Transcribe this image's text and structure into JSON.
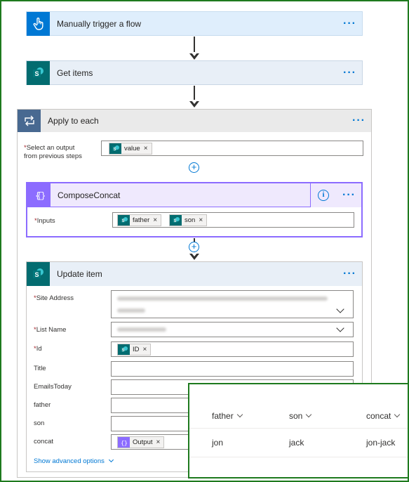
{
  "trigger": {
    "title": "Manually trigger a flow",
    "more": "···"
  },
  "get_items": {
    "title": "Get items",
    "more": "···"
  },
  "apply_each": {
    "title": "Apply to each",
    "more": "···",
    "select_label_line1": "Select an output",
    "select_label_line2": "from previous steps",
    "token": "value"
  },
  "compose": {
    "title": "ComposeConcat",
    "more": "···",
    "info": "i",
    "inputs_label": "Inputs",
    "tokens": [
      "father",
      "son"
    ]
  },
  "update_item": {
    "title": "Update item",
    "more": "···",
    "fields": {
      "site_address": "Site Address",
      "list_name": "List Name",
      "id": "Id",
      "title": "Title",
      "emails_today": "EmailsToday",
      "father": "father",
      "son": "son",
      "concat": "concat"
    },
    "id_token": "ID",
    "concat_token": "Output",
    "advanced": "Show advanced options"
  },
  "list_view": {
    "columns": [
      "father",
      "son",
      "concat"
    ],
    "row": [
      "jon",
      "jack",
      "jon-jack"
    ]
  },
  "required_marker": "*",
  "remove_x": "×",
  "colors": {
    "trigger_header": "#dfeefc",
    "trigger_icon": "#0078d4",
    "sharepoint_header": "#e8eff7",
    "sharepoint_icon": "#036c70",
    "apply_header": "#eaeaea",
    "apply_icon": "#486991",
    "compose_header": "#efe9fd",
    "compose_icon": "#8c6cff",
    "frame": "#1e7a1e"
  },
  "icons": {
    "trigger": "hand-touch-icon",
    "sharepoint": "sharepoint-icon",
    "loop": "loop-icon",
    "compose": "compose-braces-icon"
  }
}
